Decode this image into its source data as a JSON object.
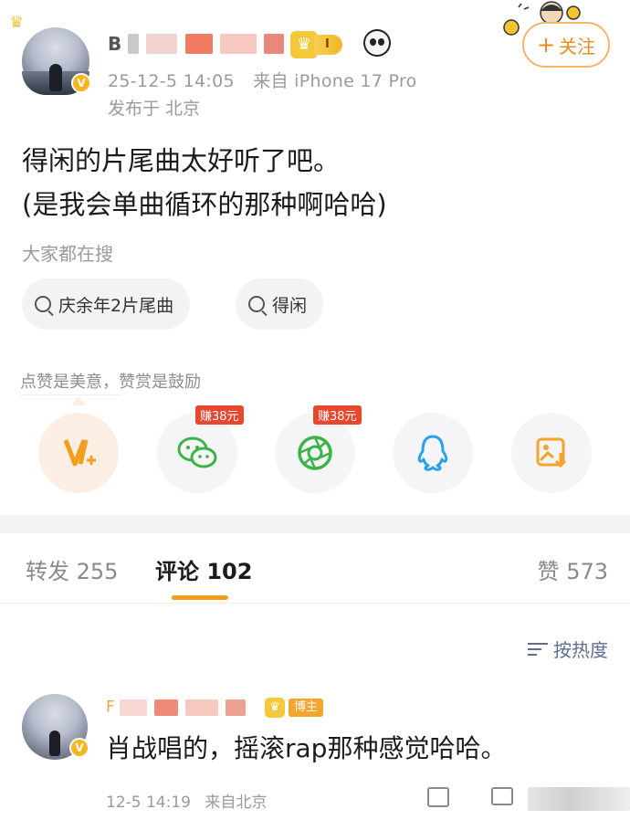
{
  "post": {
    "username_visible": "B",
    "level": "I",
    "timestamp": "25-12-5 14:05",
    "source": "来自 iPhone 17 Pro",
    "location": "发布于 北京",
    "follow_label": "关注",
    "follow_plus": "+",
    "text_line1": "得闲的片尾曲太好听了吧。",
    "text_line2": "(是我会单曲循环的那种啊哈哈)"
  },
  "search": {
    "hint": "大家都在搜",
    "chips": [
      {
        "label": "庆余年2片尾曲",
        "icon": "search-icon"
      },
      {
        "label": "得闲",
        "icon": "search-icon"
      }
    ]
  },
  "reward": {
    "hint": "点赞是美意，赞赏是鼓励",
    "buttons": [
      {
        "name": "reward-v-plus",
        "icon": "v-plus-icon",
        "tag": ""
      },
      {
        "name": "share-wechat",
        "icon": "wechat-icon",
        "tag": "赚38元"
      },
      {
        "name": "share-moments",
        "icon": "moments-icon",
        "tag": "赚38元"
      },
      {
        "name": "share-qq",
        "icon": "qq-icon",
        "tag": ""
      },
      {
        "name": "save-image",
        "icon": "image-download-icon",
        "tag": ""
      }
    ]
  },
  "tabs": {
    "repost_label": "转发",
    "repost_count": "255",
    "comments_label": "评论",
    "comments_count": "102",
    "likes_label": "赞",
    "likes_count": "573"
  },
  "sort_label": "按热度",
  "comment": {
    "username_visible": "F",
    "badge": "博主",
    "text": "肖战唱的，摇滚rap那种感觉哈哈。",
    "timestamp": "12-5 14:19",
    "source": "来自北京"
  },
  "colors": {
    "accent": "#f29e1d",
    "follow_border": "#f3b66c",
    "tag_red": "#e8472f",
    "wechat_green": "#3cb346",
    "qq_blue": "#2ba1e6",
    "image_orange": "#f2a42c"
  }
}
